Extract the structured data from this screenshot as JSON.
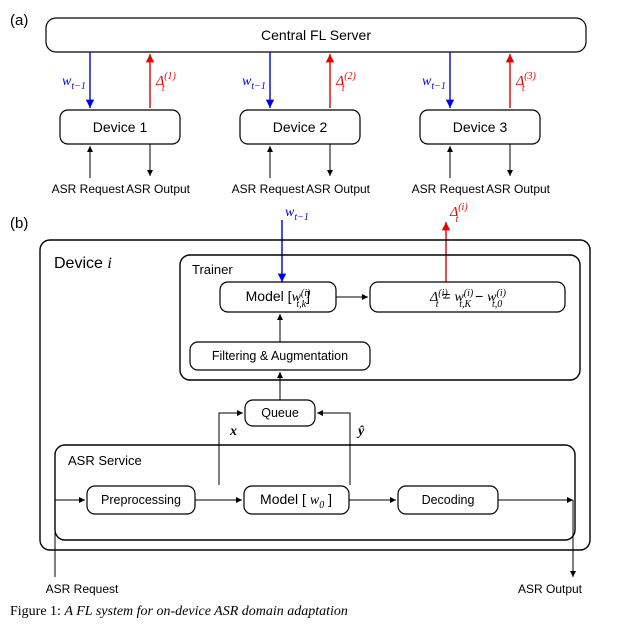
{
  "subfigA_label": "(a)",
  "subfigB_label": "(b)",
  "server_title": "Central FL Server",
  "devices": [
    {
      "name": "Device 1",
      "asr_req": "ASR Request",
      "asr_out": "ASR Output",
      "w_label": "w",
      "w_sub": "t−1",
      "d_label": "Δ",
      "d_sub": "t",
      "d_sup": "(1)"
    },
    {
      "name": "Device 2",
      "asr_req": "ASR Request",
      "asr_out": "ASR Output",
      "w_label": "w",
      "w_sub": "t−1",
      "d_label": "Δ",
      "d_sub": "t",
      "d_sup": "(2)"
    },
    {
      "name": "Device 3",
      "asr_req": "ASR Request",
      "asr_out": "ASR Output",
      "w_label": "w",
      "w_sub": "t−1",
      "d_label": "Δ",
      "d_sub": "t",
      "d_sup": "(3)"
    }
  ],
  "deviceI_title": "Device",
  "deviceI_var": "i",
  "trainer_title": "Trainer",
  "asr_service_title": "ASR Service",
  "model_trainer_prefix": "Model [",
  "model_trainer_w": "w",
  "model_trainer_sub": "t,k",
  "model_trainer_sup": "(i)",
  "model_trainer_suffix": "]",
  "delta_eq_lhs": "Δ",
  "delta_eq_sub": "t",
  "delta_eq_sup": "(i)",
  "delta_eq_eq": " = ",
  "delta_eq_r1": "w",
  "delta_eq_r1_sub": "t,K",
  "delta_eq_r1_sup": "(i)",
  "delta_eq_minus": " − ",
  "delta_eq_r2": "w",
  "delta_eq_r2_sub": "t,0",
  "delta_eq_r2_sup": "(i)",
  "filter_label": "Filtering & Augmentation",
  "queue_label": "Queue",
  "x_label": "x",
  "yhat_label": "ŷ",
  "preproc_label": "Preprocessing",
  "model_w0_prefix": "Model [ ",
  "model_w0_var": "w",
  "model_w0_sub": "0",
  "model_w0_suffix": " ]",
  "decoding_label": "Decoding",
  "asr_req_b": "ASR Request",
  "asr_out_b": "ASR Output",
  "top_in_w": "w",
  "top_in_w_sub": "t−1",
  "top_out_d": "Δ",
  "top_out_d_sub": "t",
  "top_out_d_sup": "(i)",
  "chart_data": {
    "type": "diagram",
    "description": "Federated learning architecture: (a) central FL server sends weights w_{t-1} to devices 1..3 and receives deltas Δ_t^{(i)}; each device also handles ASR Request → ASR Output. (b) Inside Device i: ASR Service pipeline Preprocessing → Model[w0] → Decoding producing ŷ; (x, ŷ) go to Queue → Filtering & Augmentation → Trainer Model[w_{t,k}^{(i)}] which computes Δ_t^{(i)} = w_{t,K}^{(i)} − w_{t,0}^{(i)} and emits Δ_t^{(i)}; w_{t-1} enters the trainer model."
  },
  "caption_prefix": "Figure 1:",
  "caption_rest": "A FL system for on-device ASR domain adaptation"
}
